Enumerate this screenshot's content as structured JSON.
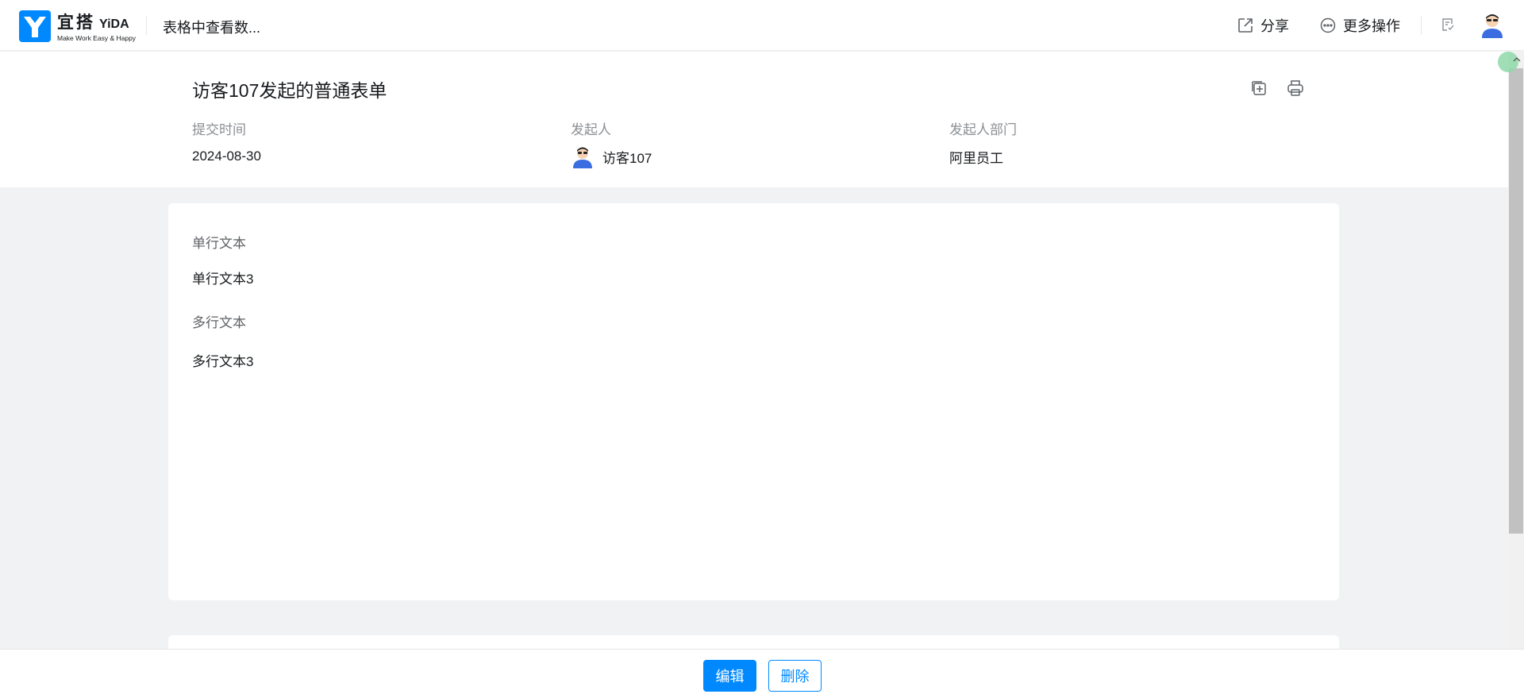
{
  "header": {
    "logo_cn": "宜搭",
    "logo_en": "YiDA",
    "logo_slogan": "Make Work Easy & Happy",
    "app_title": "表格中查看数...",
    "share_label": "分享",
    "more_label": "更多操作",
    "icons": [
      "share-icon",
      "more-icon",
      "todo-icon",
      "avatar"
    ]
  },
  "summary": {
    "title": "访客107发起的普通表单",
    "submit_time_label": "提交时间",
    "submit_time": "2024-08-30",
    "initiator_label": "发起人",
    "initiator": "访客107",
    "department_label": "发起人部门",
    "department": "阿里员工"
  },
  "form": {
    "fields": [
      {
        "label": "单行文本",
        "value": "单行文本3"
      },
      {
        "label": "多行文本",
        "value": "多行文本3"
      }
    ]
  },
  "footer": {
    "edit_label": "编辑",
    "delete_label": "删除"
  },
  "colors": {
    "brand": "#0089ff",
    "background": "#f1f2f3",
    "text": "#171a1d",
    "muted": "#8c8f93"
  }
}
